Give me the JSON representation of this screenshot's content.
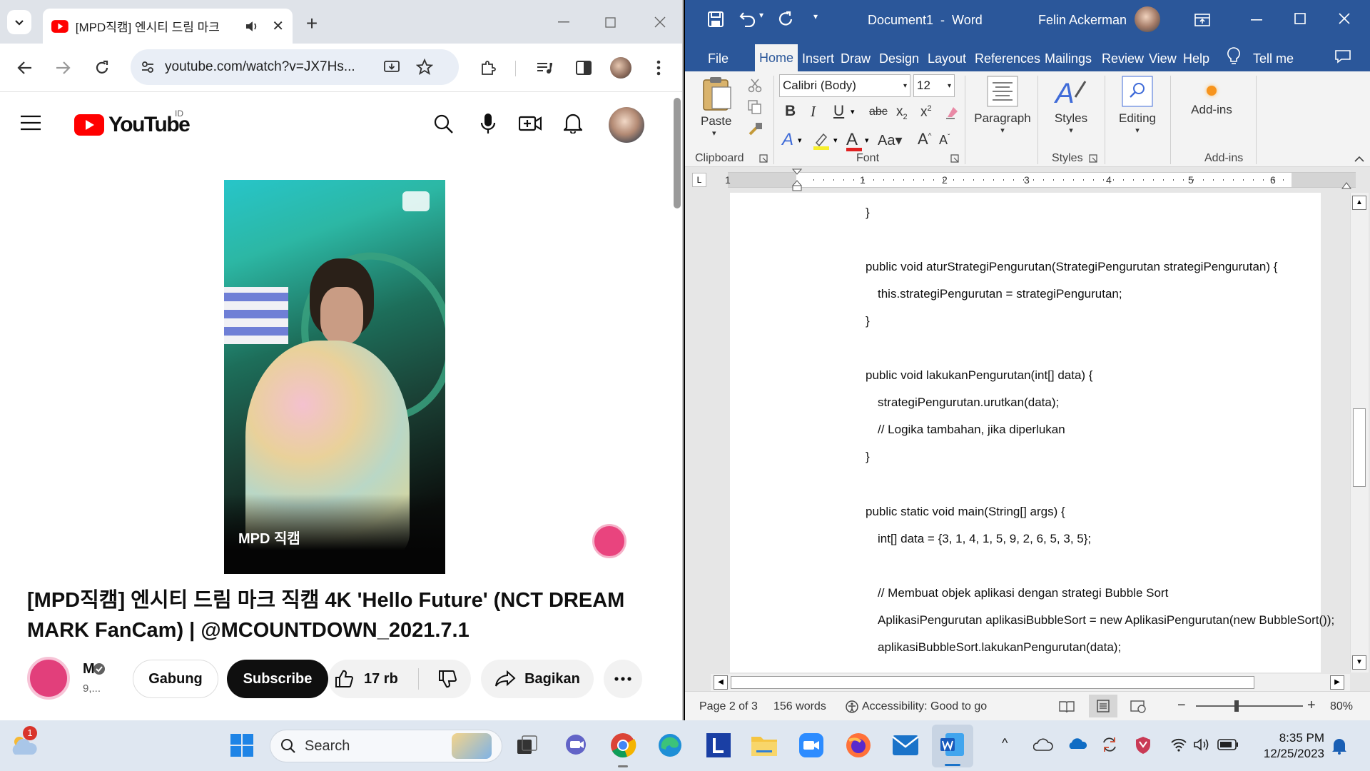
{
  "chrome": {
    "tab_title": "[MPD직캠] 엔시티 드림 마크",
    "url": "youtube.com/watch?v=JX7Hs...",
    "new_tab_symbol": "+"
  },
  "youtube": {
    "logo": "YouTube",
    "region": "ID",
    "video_title_line1": "[MPD직캠] 엔시티 드림 마크 직캠 4K 'Hello Future' (NCT DREAM",
    "video_title_line2": "MARK FanCam) | @MCOUNTDOWN_2021.7.1",
    "channel_name": "M",
    "channel_subs": "9,...",
    "join_label": "Gabung",
    "subscribe_label": "Subscribe",
    "like_count": "17 rb",
    "share_label": "Bagikan",
    "watermark": "MPD 직캠"
  },
  "word": {
    "title": "Document1  -  Word",
    "user": "Felin Ackerman",
    "tabs": [
      "File",
      "Home",
      "Insert",
      "Draw",
      "Design",
      "Layout",
      "References",
      "Mailings",
      "Review",
      "View",
      "Help"
    ],
    "tell_me": "Tell me",
    "font_name": "Calibri (Body)",
    "font_size": "12",
    "paste_label": "Paste",
    "paragraph_label": "Paragraph",
    "styles_label": "Styles",
    "editing_label": "Editing",
    "addins_label": "Add-ins",
    "group_clipboard": "Clipboard",
    "group_font": "Font",
    "group_styles": "Styles",
    "group_addins": "Add-ins",
    "ruler_numbers": [
      "1",
      "1",
      "2",
      "3",
      "4",
      "5",
      "6"
    ],
    "code_lines": [
      "}",
      "public void aturStrategiPengurutan(StrategiPengurutan strategiPengurutan) {",
      "this.strategiPengurutan = strategiPengurutan;",
      "}",
      "public void lakukanPengurutan(int[] data) {",
      "strategiPengurutan.urutkan(data);",
      "// Logika tambahan, jika diperlukan",
      "}",
      "public static void main(String[] args) {",
      "int[] data = {3, 1, 4, 1, 5, 9, 2, 6, 5, 3, 5};",
      "// Membuat objek aplikasi dengan strategi Bubble Sort",
      "AplikasiPengurutan aplikasiBubbleSort = new AplikasiPengurutan(new BubbleSort());",
      "aplikasiBubbleSort.lakukanPengurutan(data);"
    ],
    "status_page": "Page 2 of 3",
    "status_words": "156 words",
    "status_accessibility": "Accessibility: Good to go",
    "zoom": "80%"
  },
  "taskbar": {
    "search_placeholder": "Search",
    "notification_badge": "1",
    "time": "8:35 PM",
    "date": "12/25/2023"
  }
}
